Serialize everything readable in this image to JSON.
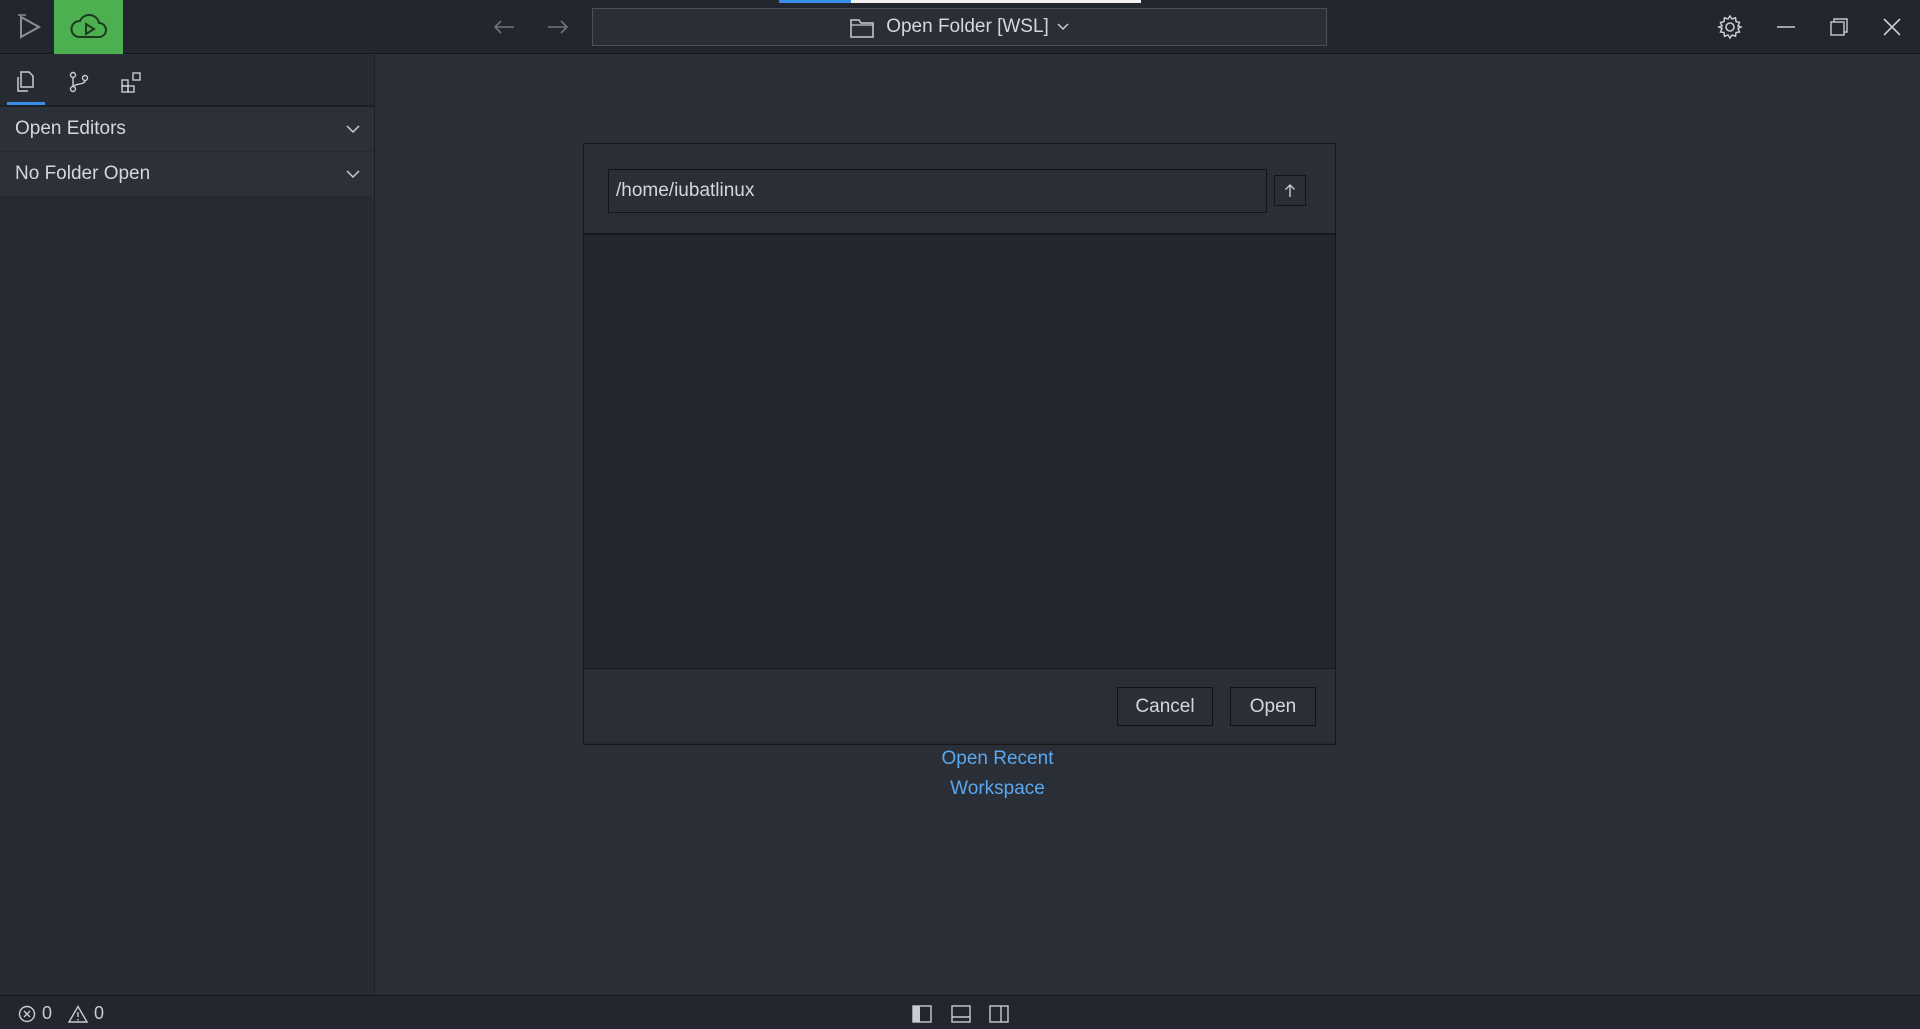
{
  "titlebar": {
    "command_center_label": "Open Folder [WSL]",
    "icons": [
      "app-logo-icon",
      "cloud-play-icon",
      "arrow-left-icon",
      "arrow-right-icon",
      "folder-icon",
      "chevron-down-icon",
      "gear-icon",
      "minimize-icon",
      "restore-icon",
      "close-icon"
    ]
  },
  "sidebar": {
    "tabs": [
      "explorer-icon",
      "source-control-icon",
      "extensions-icon"
    ],
    "sections": [
      {
        "label": "Open Editors"
      },
      {
        "label": "No Folder Open"
      }
    ]
  },
  "dialog": {
    "path_value": "/home/iubatlinux",
    "cancel_label": "Cancel",
    "open_label": "Open"
  },
  "recent_link": "Open Recent Workspace",
  "statusbar": {
    "errors": "0",
    "warnings": "0"
  },
  "colors": {
    "accent": "#3a8ee6",
    "cloud_bg": "#4caf50",
    "link": "#5ba8f0"
  }
}
